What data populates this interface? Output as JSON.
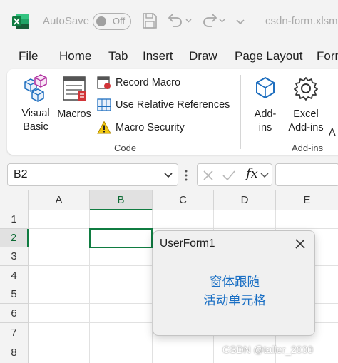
{
  "titlebar": {
    "autosave_label": "AutoSave",
    "autosave_state": "Off",
    "filename": "csdn-form.xlsm"
  },
  "tabs": [
    "File",
    "Home",
    "Tab",
    "Insert",
    "Draw",
    "Page Layout",
    "Form"
  ],
  "ribbon": {
    "code_group": {
      "label": "Code",
      "visual_basic": [
        "Visual",
        "Basic"
      ],
      "macros": "Macros",
      "record_macro": "Record Macro",
      "relative_refs": "Use Relative References",
      "macro_security": "Macro Security"
    },
    "addins_group": {
      "label": "Add-ins",
      "addins": [
        "Add-",
        "ins"
      ],
      "excel_addins": [
        "Excel",
        "Add-ins"
      ],
      "cut_label": "A"
    }
  },
  "formula_bar": {
    "name_box": "B2",
    "fx": "fx"
  },
  "grid": {
    "columns": [
      "A",
      "B",
      "C",
      "D",
      "E"
    ],
    "rows": [
      "1",
      "2",
      "3",
      "4",
      "5",
      "6",
      "7",
      "8"
    ],
    "selected_column": "B",
    "selected_row": "2"
  },
  "userform": {
    "title": "UserForm1",
    "label_lines": [
      "窗体跟随",
      "活动单元格"
    ]
  },
  "watermark": "CSDN @taller_2000",
  "colors": {
    "excel_green": "#107c41",
    "link_blue": "#1a6fc4",
    "ribbon_icon_blue": "#1f6fbf"
  }
}
